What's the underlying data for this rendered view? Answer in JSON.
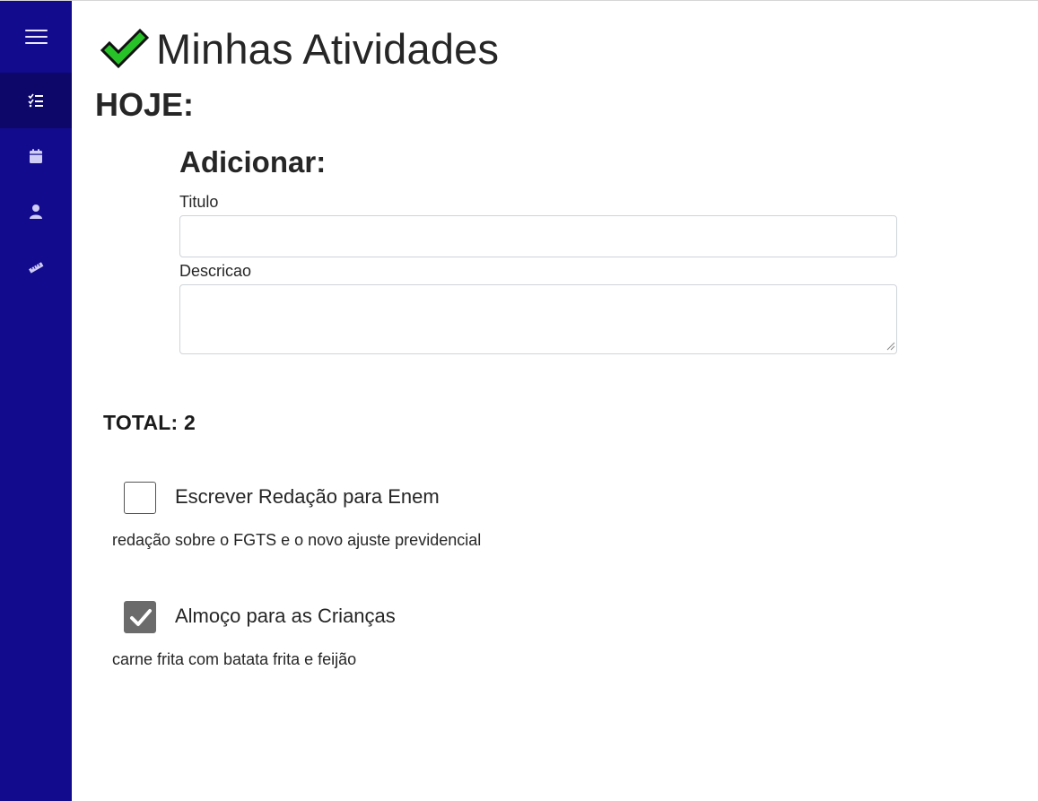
{
  "app": {
    "title": "Minhas Atividades",
    "accent_color": "#120b8e",
    "check_color": "#27c227"
  },
  "sidebar": {
    "items": [
      {
        "icon": "list-check-icon",
        "active": true
      },
      {
        "icon": "calendar-icon",
        "active": false
      },
      {
        "icon": "user-icon",
        "active": false
      },
      {
        "icon": "ruler-icon",
        "active": false
      }
    ]
  },
  "section": {
    "label": "HOJE:"
  },
  "form": {
    "heading": "Adicionar:",
    "title_label": "Titulo",
    "title_value": "",
    "description_label": "Descricao",
    "description_value": ""
  },
  "summary": {
    "total_text": "TOTAL: 2"
  },
  "tasks": [
    {
      "title": "Escrever Redação para Enem",
      "description": "redação sobre o FGTS e o novo ajuste previdencial",
      "done": false
    },
    {
      "title": "Almoço para as Crianças",
      "description": "carne frita com batata frita e feijão",
      "done": true
    }
  ]
}
